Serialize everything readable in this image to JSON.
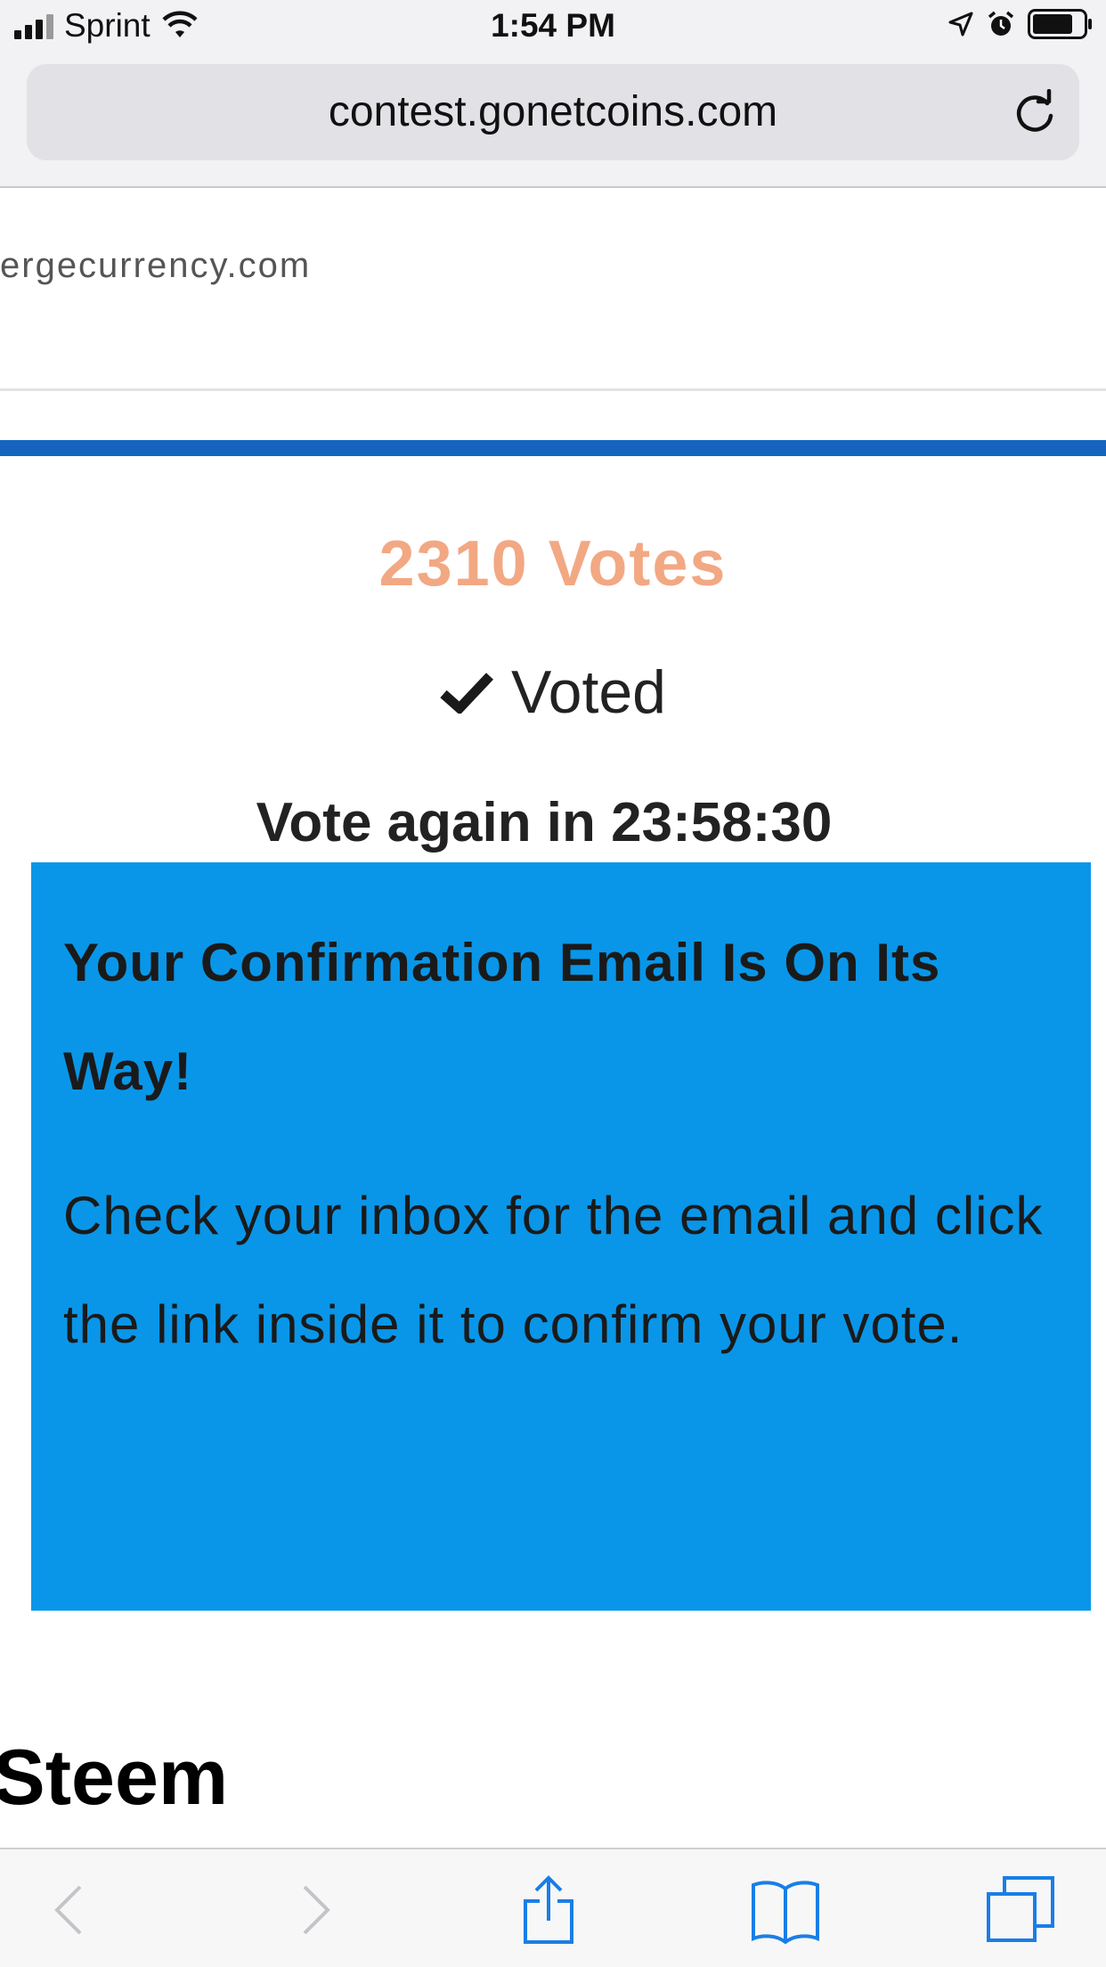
{
  "status_bar": {
    "carrier": "Sprint",
    "time": "1:54 PM"
  },
  "browser": {
    "url": "contest.gonetcoins.com"
  },
  "page": {
    "site_snippet": "ergecurrency.com",
    "votes_count": "2310 Votes",
    "voted_label": "Voted",
    "vote_again": "Vote again in 23:58:30",
    "confirmation": {
      "title": "Your Confirmation Email Is On Its Way!",
      "body": "Check your inbox for the email and click the link inside it to confirm your vote."
    },
    "next_heading": "Steem"
  },
  "colors": {
    "votes_accent": "#f2a883",
    "divider_blue": "#1565c0",
    "confirm_bg": "#0996e8"
  }
}
